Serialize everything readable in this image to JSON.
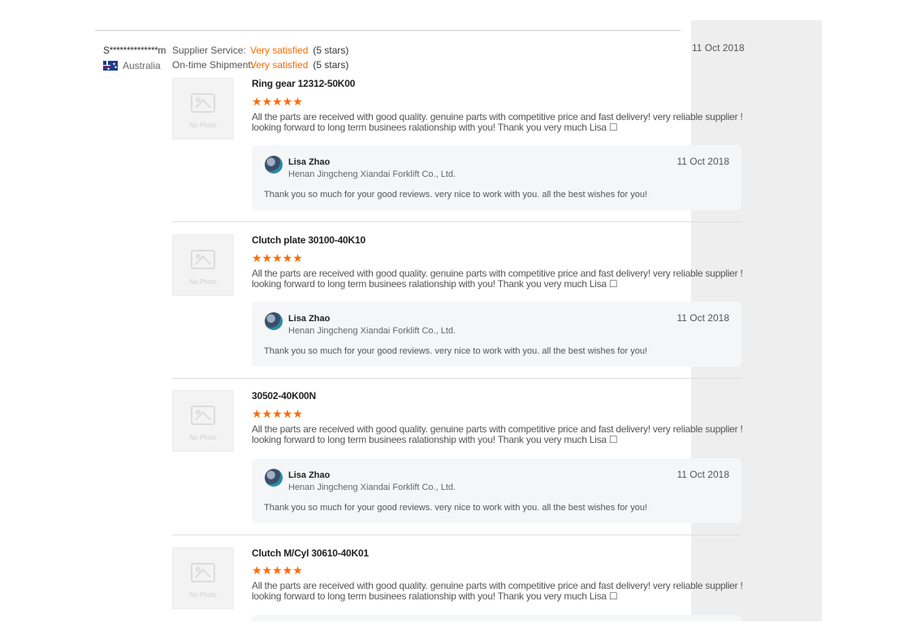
{
  "buyer": {
    "name": "S**************m",
    "country": "Australia",
    "date": "11 Oct 2018",
    "ratings": [
      {
        "label": "Supplier Service:",
        "value": "Very satisfied",
        "stars": "(5 stars)"
      },
      {
        "label": "On-time Shipment:",
        "value": "Very satisfied",
        "stars": "(5 stars)"
      }
    ]
  },
  "no_photo_text": "No Photo",
  "stars_glyphs": "★★★★★",
  "reviews": [
    {
      "product": "Ring gear 12312-50K00",
      "rating": 5,
      "content": "All the parts are received with good quality. genuine parts with competitive price and fast delivery! very reliable supplier ! looking forward to long term businees ralationship with you! Thank you very much Lisa ☐",
      "reply": {
        "name": "Lisa Zhao",
        "company": "Henan Jingcheng Xiandai Forklift Co., Ltd.",
        "date": "11 Oct 2018",
        "text": "Thank you so much for your good reviews. very nice to work with you. all the best wishes for you!"
      }
    },
    {
      "product": "Clutch plate 30100-40K10",
      "rating": 5,
      "content": "All the parts are received with good quality. genuine parts with competitive price and fast delivery! very reliable supplier ! looking forward to long term businees ralationship with you! Thank you very much Lisa ☐",
      "reply": {
        "name": "Lisa Zhao",
        "company": "Henan Jingcheng Xiandai Forklift Co., Ltd.",
        "date": "11 Oct 2018",
        "text": "Thank you so much for your good reviews. very nice to work with you. all the best wishes for you!"
      }
    },
    {
      "product": "30502-40K00N",
      "rating": 5,
      "content": "All the parts are received with good quality. genuine parts with competitive price and fast delivery! very reliable supplier ! looking forward to long term businees ralationship with you! Thank you very much Lisa ☐",
      "reply": {
        "name": "Lisa Zhao",
        "company": "Henan Jingcheng Xiandai Forklift Co., Ltd.",
        "date": "11 Oct 2018",
        "text": "Thank you so much for your good reviews. very nice to work with you. all the best wishes for you!"
      }
    },
    {
      "product": "Clutch M/Cyl 30610-40K01",
      "rating": 5,
      "content": "All the parts are received with good quality. genuine parts with competitive price and fast delivery! very reliable supplier ! looking forward to long term businees ralationship with you! Thank you very much Lisa ☐"
    }
  ],
  "colors": {
    "accent": "#ff6a00",
    "panel": "#eeeeee",
    "reply_bg": "#f5f6f7"
  }
}
